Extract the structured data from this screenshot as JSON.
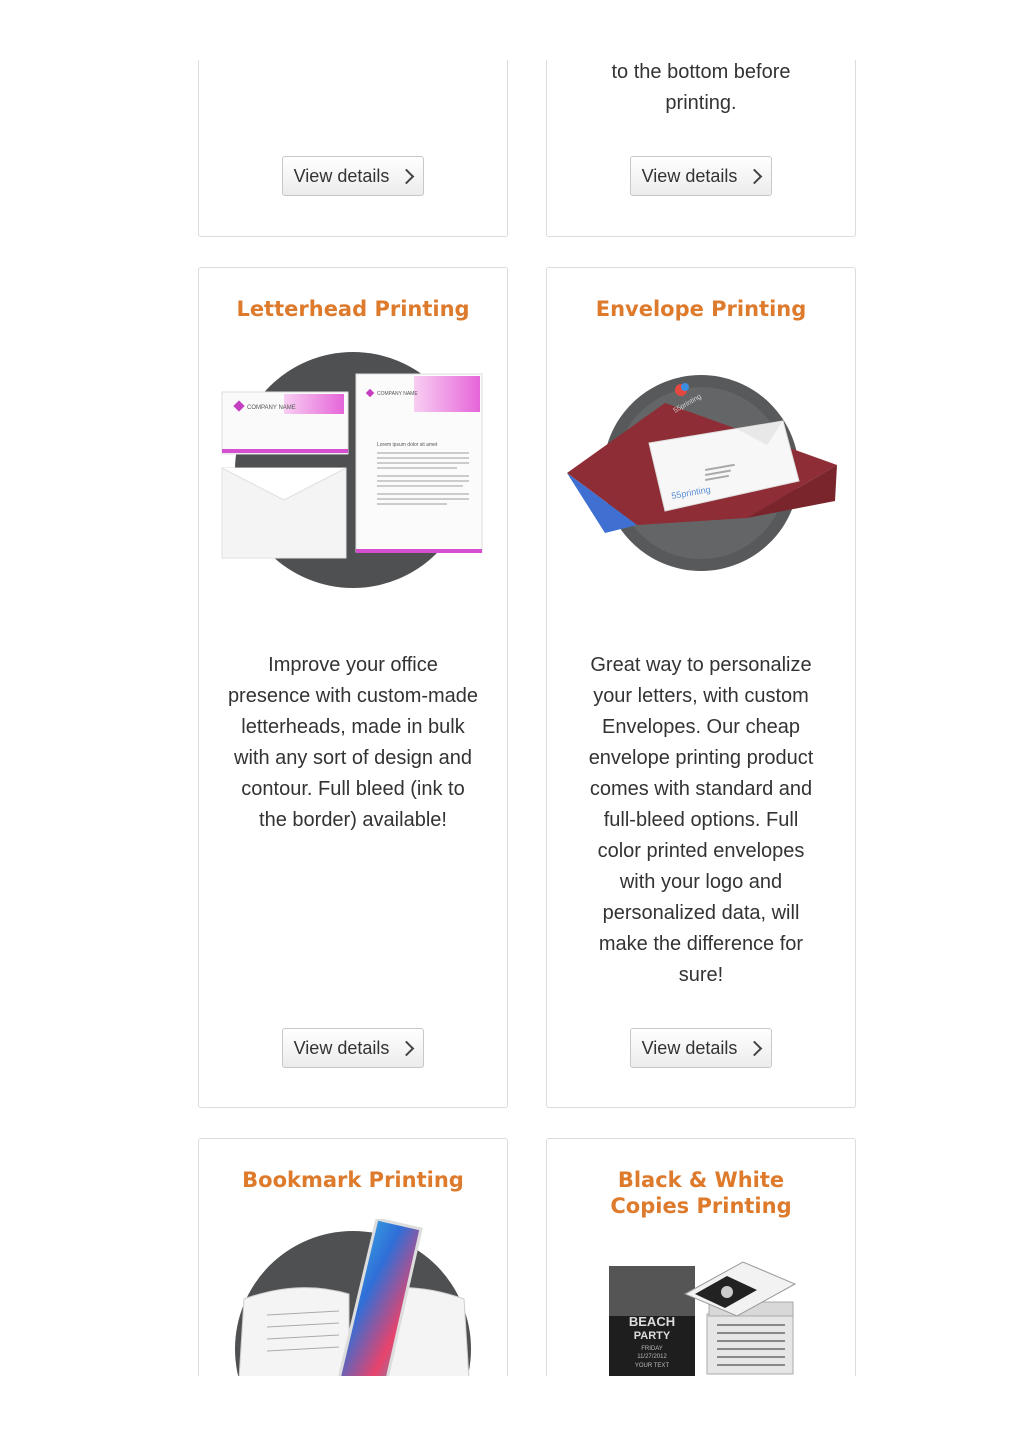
{
  "cards": {
    "top_left": {
      "button": "View details"
    },
    "top_right": {
      "desc": "to the bottom before printing.",
      "button": "View details"
    },
    "letterhead": {
      "title": "Letterhead Printing",
      "desc": "Improve your office presence with custom-made letterheads, made in bulk with any sort of design and contour. Full bleed (ink to the border) available!",
      "button": "View details",
      "image_text": {
        "company": "COMPANY NAME",
        "company2": "COMPANY NAME",
        "lorem": "Lorem ipsum dolor sit amet"
      }
    },
    "envelope": {
      "title": "Envelope Printing",
      "desc": "Great way to personalize your letters, with custom Envelopes. Our cheap envelope printing product comes with standard and full-bleed options.  Full color printed envelopes with your logo and personalized data, will make the difference for sure!",
      "button": "View details",
      "image_text": {
        "brand": "55printing",
        "brand2": "55printing"
      }
    },
    "bookmark": {
      "title": "Bookmark Printing"
    },
    "bw_copies": {
      "title": "Black & White Copies Printing",
      "image_text": {
        "line1": "BEACH",
        "line2": "PARTY",
        "line3": "FRIDAY",
        "line4": "11/27/2012",
        "line5": "YOUR TEXT"
      }
    }
  },
  "colors": {
    "title": "#dd7a2c",
    "text": "#333333",
    "border": "#dcdcdc"
  }
}
